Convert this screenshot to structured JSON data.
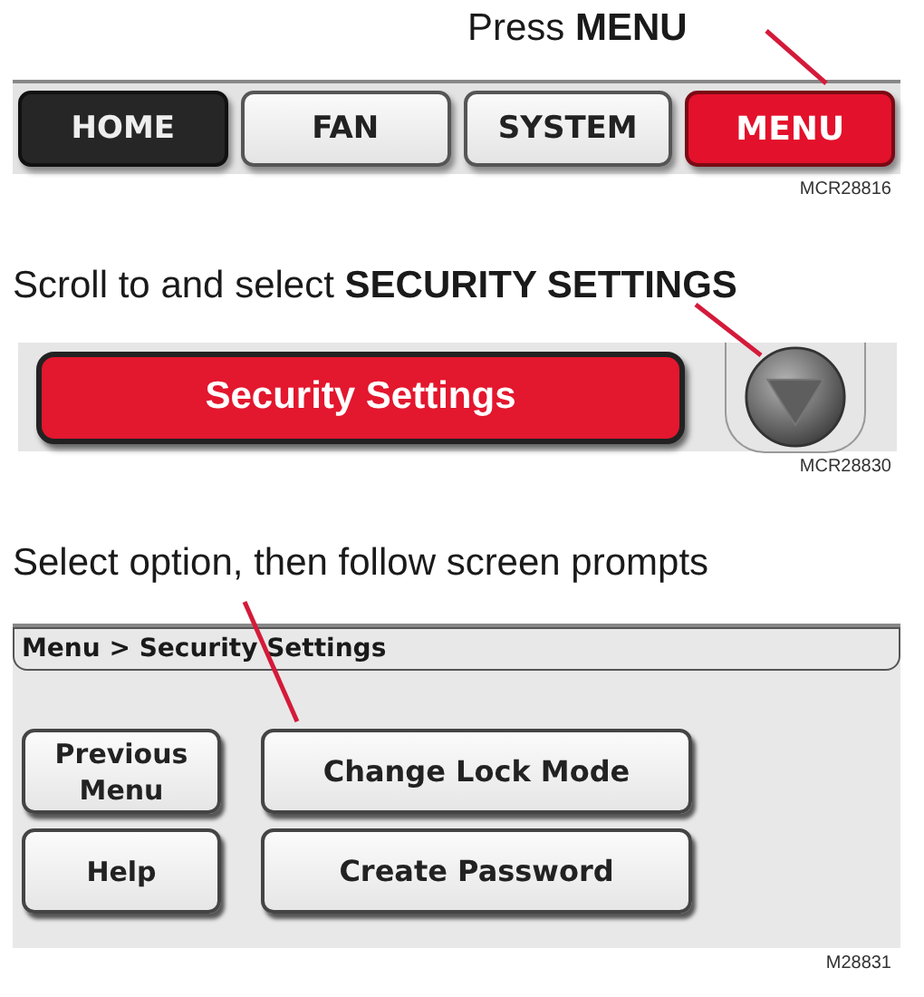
{
  "steps": [
    {
      "caption": "Press **MENU**",
      "figure_code": "MCR28816",
      "kind": "nav",
      "buttons": [
        {
          "label": "HOME",
          "kind": "dark"
        },
        {
          "label": "FAN",
          "kind": "light"
        },
        {
          "label": "SYSTEM",
          "kind": "light"
        },
        {
          "label": "MENU",
          "kind": "red"
        }
      ]
    },
    {
      "caption": "Scroll to and select **SECURITY SETTINGS**",
      "figure_code": "MCR28830",
      "kind": "scroll",
      "item": "Security Settings"
    },
    {
      "caption": "Select option, then follow screen prompts",
      "figure_code": "M28831",
      "kind": "menu",
      "breadcrumb": "Menu > Security Settings",
      "buttons": [
        {
          "label": "Previous Menu",
          "kind": "side"
        },
        {
          "label": "Change Lock Mode",
          "kind": "wide"
        },
        {
          "label": "Help",
          "kind": "side"
        },
        {
          "label": "Create Password",
          "kind": "wide"
        }
      ]
    }
  ]
}
